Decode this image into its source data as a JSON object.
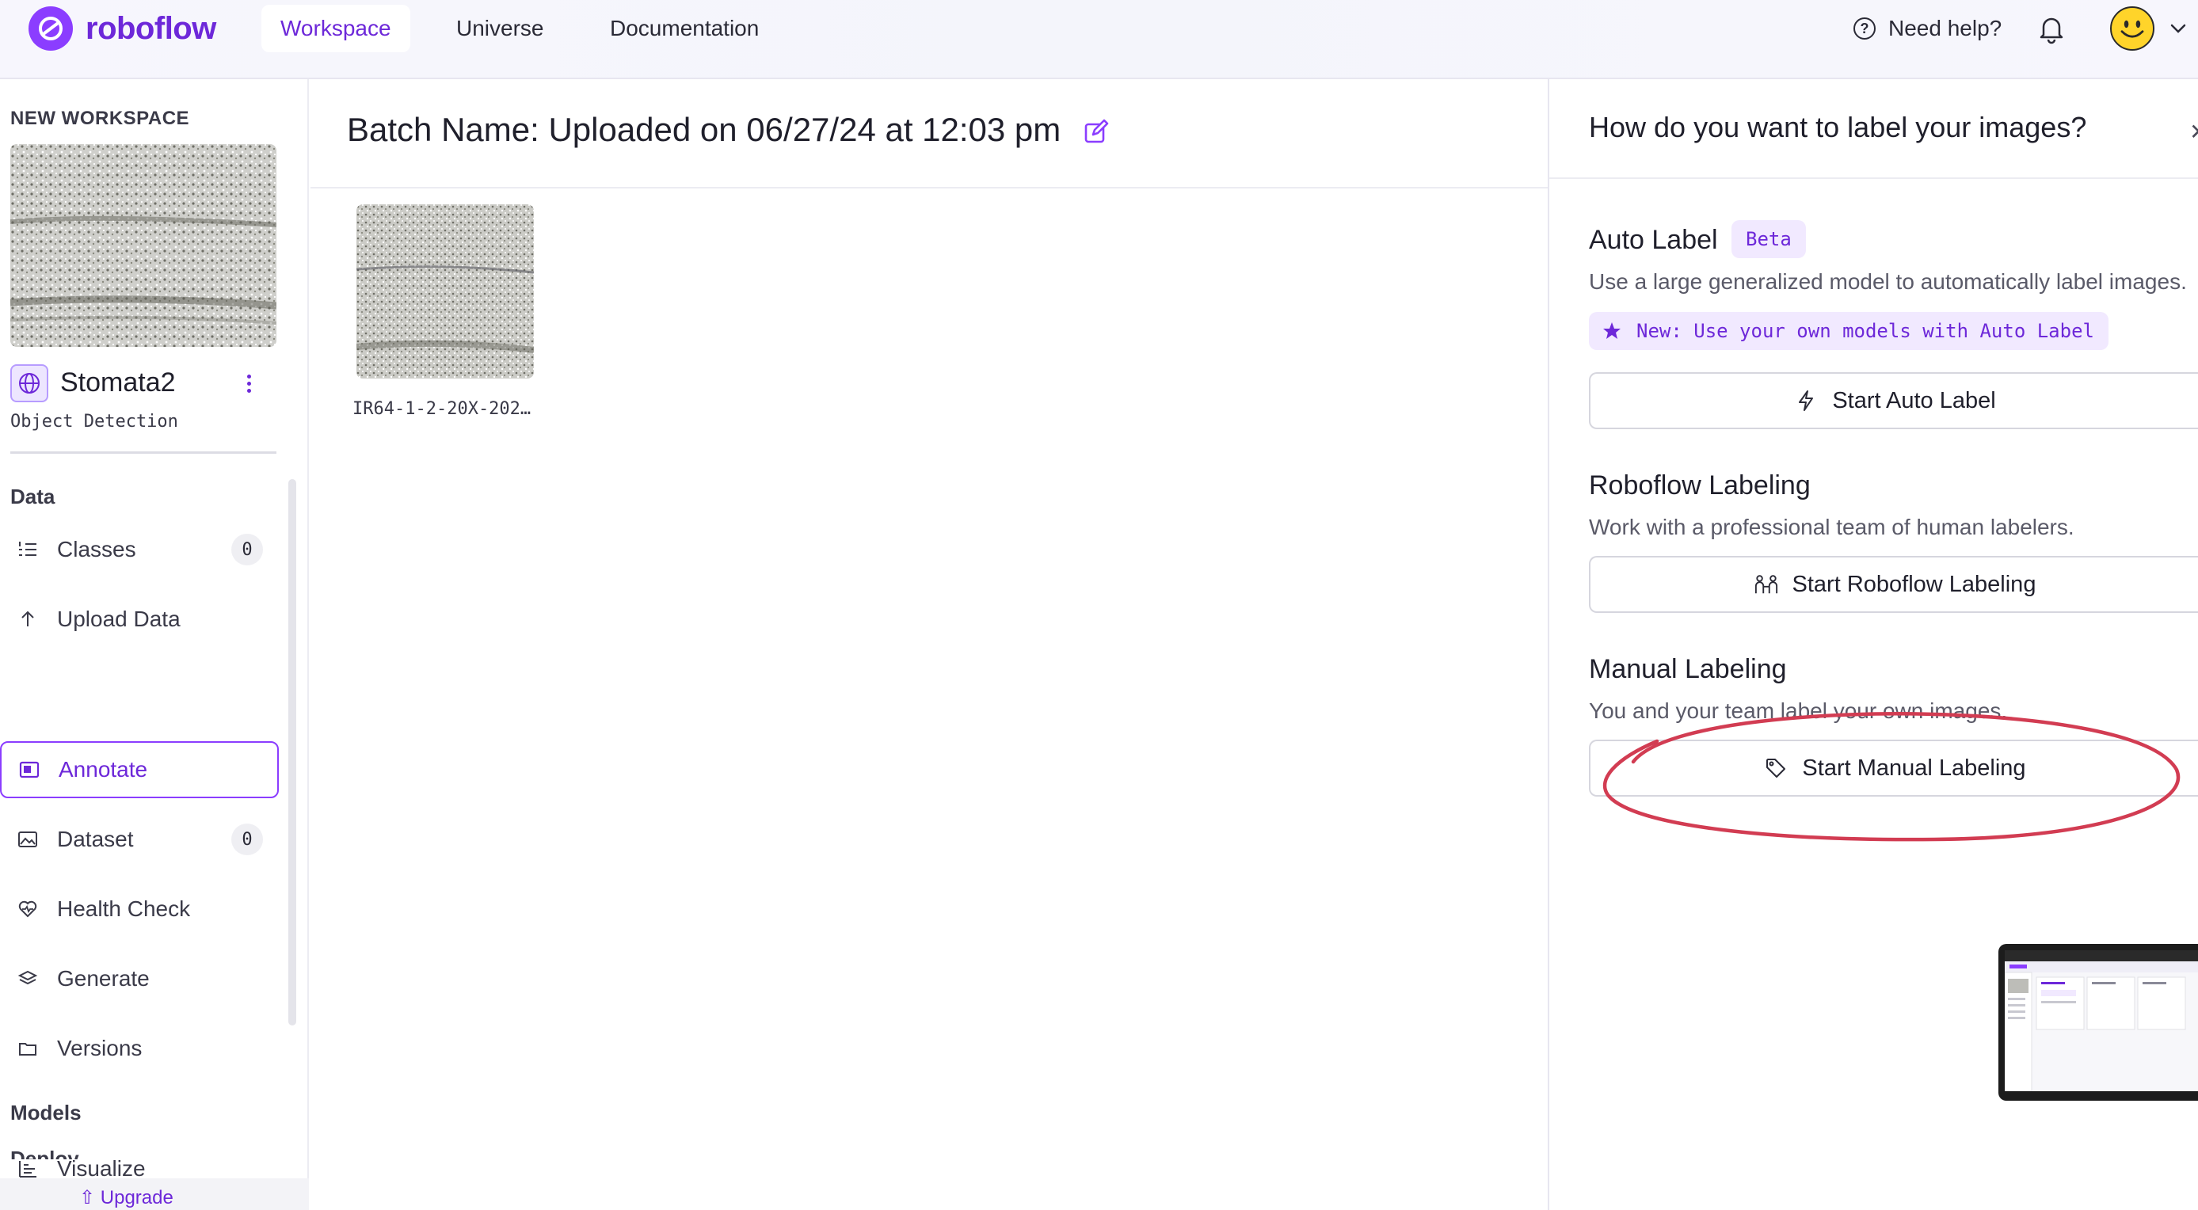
{
  "app": {
    "brand": "roboflow",
    "accent_color": "#6d28d9",
    "accent_light": "#f1e9ff"
  },
  "topnav": {
    "tabs": [
      {
        "label": "Workspace",
        "active": true
      },
      {
        "label": "Universe",
        "active": false
      },
      {
        "label": "Documentation",
        "active": false
      }
    ],
    "help_label": "Need help?",
    "help_icon": "question-circle-icon",
    "notification_icon": "bell-icon",
    "avatar_icon": "smiley-face-icon"
  },
  "sidebar": {
    "workspace_label": "NEW WORKSPACE",
    "project": {
      "name": "Stomata2",
      "type": "Object Detection"
    },
    "sections": {
      "data": "Data",
      "models": "Models",
      "deploy": "Deploy"
    },
    "items": [
      {
        "label": "Classes",
        "icon": "list-numbered-icon",
        "count": "0"
      },
      {
        "label": "Upload Data",
        "icon": "arrow-up-icon"
      },
      {
        "label": "Annotate",
        "icon": "annotate-icon",
        "active": true
      },
      {
        "label": "Dataset",
        "icon": "image-icon",
        "count": "0"
      },
      {
        "label": "Health Check",
        "icon": "heart-pulse-icon"
      },
      {
        "label": "Generate",
        "icon": "layers-icon"
      },
      {
        "label": "Versions",
        "icon": "folders-icon"
      },
      {
        "label": "Visualize",
        "icon": "bar-chart-icon"
      }
    ],
    "upgrade_label": "Upgrade"
  },
  "main": {
    "batch_title": "Batch Name: Uploaded on 06/27/24 at 12:03 pm",
    "images": [
      {
        "name": "IR64-1-2-20X-202…"
      }
    ]
  },
  "panel": {
    "title": "How do you want to label your images?",
    "auto_label": {
      "title": "Auto Label",
      "badge": "Beta",
      "description": "Use a large generalized model to automatically label images.",
      "promo": "New: Use your own models with Auto Label",
      "button": "Start Auto Label"
    },
    "roboflow_labeling": {
      "title": "Roboflow Labeling",
      "description": "Work with a professional team of human labelers.",
      "button": "Start Roboflow Labeling"
    },
    "manual_labeling": {
      "title": "Manual Labeling",
      "description": "You and your team label your own images.",
      "button": "Start Manual Labeling"
    },
    "annotation_color": "#d23c52"
  }
}
